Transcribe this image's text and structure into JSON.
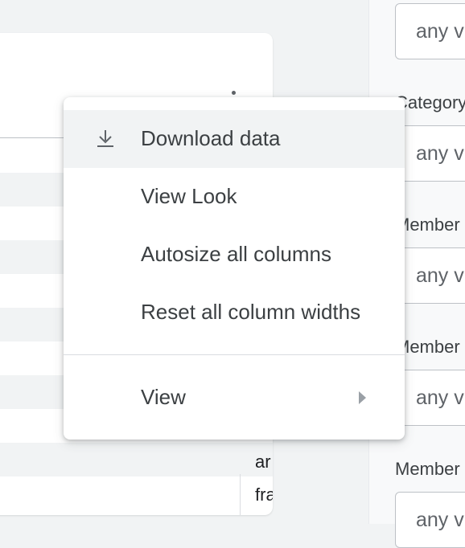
{
  "filters": {
    "inputs": [
      "any v",
      "any v",
      "any v",
      "any v",
      "any v"
    ],
    "labels": [
      "Category",
      "Member",
      "Member",
      "Member"
    ]
  },
  "table": {
    "visible_cells": [
      "ar",
      "fra"
    ]
  },
  "menu": {
    "items": [
      {
        "label": "Download data",
        "icon": "download-icon"
      },
      {
        "label": "View Look"
      },
      {
        "label": "Autosize all columns"
      },
      {
        "label": "Reset all column widths"
      },
      {
        "label": "View",
        "submenu": true
      }
    ]
  }
}
